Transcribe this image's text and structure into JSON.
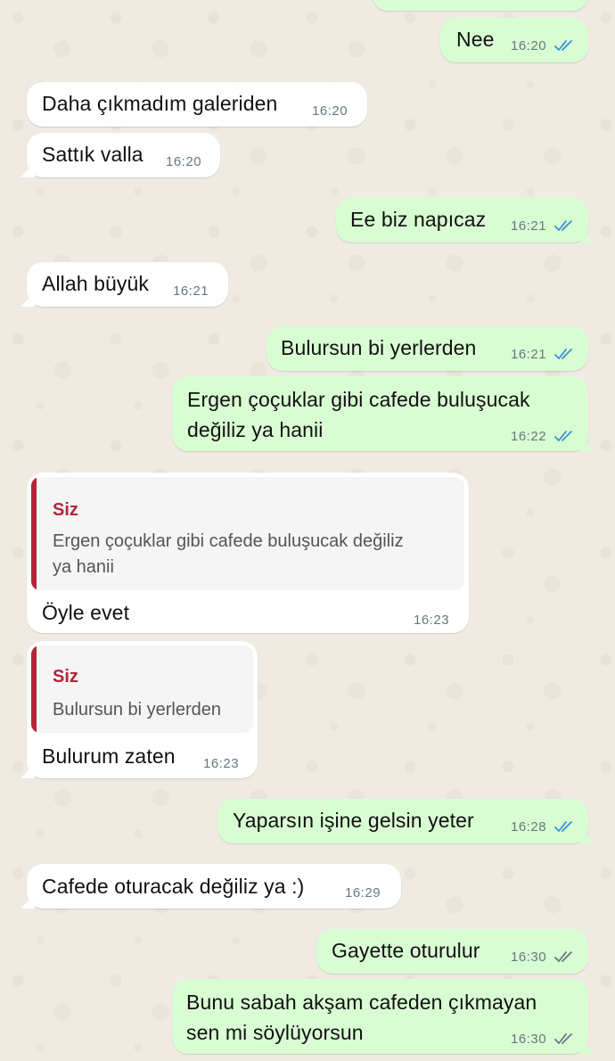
{
  "colors": {
    "wallpaper": "#efeae2",
    "outgoing_bubble": "#d9fdd3",
    "incoming_bubble": "#ffffff",
    "read_ticks": "#3a8fd6",
    "delivered_ticks": "#667781",
    "quote_accent": "#b3243b"
  },
  "messages": [
    {
      "direction": "out",
      "text": "Nee",
      "time": "16:20",
      "status": "read"
    },
    {
      "direction": "in",
      "text": "Daha çıkmadım galeriden",
      "time": "16:20"
    },
    {
      "direction": "in",
      "text": "Sattık valla",
      "time": "16:20"
    },
    {
      "direction": "out",
      "text": "Ee biz napıcaz",
      "time": "16:21",
      "status": "read"
    },
    {
      "direction": "in",
      "text": "Allah büyük",
      "time": "16:21"
    },
    {
      "direction": "out",
      "text": "Bulursun bi yerlerden",
      "time": "16:21",
      "status": "read"
    },
    {
      "direction": "out",
      "text_lines": [
        "Ergen çoçuklar gibi cafede buluşucak",
        "değiliz ya hanii"
      ],
      "time": "16:22",
      "status": "read"
    },
    {
      "direction": "in",
      "reply": {
        "author": "Siz",
        "text_lines": [
          "Ergen çoçuklar gibi cafede buluşucak değiliz",
          "ya hanii"
        ]
      },
      "text": "Öyle evet",
      "time": "16:23"
    },
    {
      "direction": "in",
      "reply": {
        "author": "Siz",
        "text": "Bulursun bi yerlerden"
      },
      "text": "Bulurum zaten",
      "time": "16:23"
    },
    {
      "direction": "out",
      "text": "Yaparsın işine gelsin yeter",
      "time": "16:28",
      "status": "read"
    },
    {
      "direction": "in",
      "text": "Cafede oturacak değiliz ya :)",
      "time": "16:29"
    },
    {
      "direction": "out",
      "text": "Gayette oturulur",
      "time": "16:30",
      "status": "delivered"
    },
    {
      "direction": "out",
      "text_lines": [
        "Bunu sabah akşam cafeden çıkmayan",
        "sen mi söylüyorsun"
      ],
      "time": "16:30",
      "status": "delivered"
    }
  ]
}
